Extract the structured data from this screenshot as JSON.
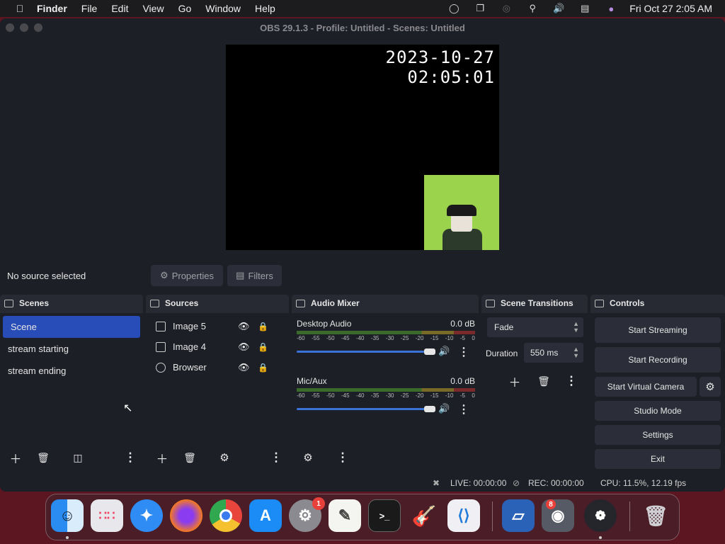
{
  "menubar": {
    "apple": "",
    "items": [
      "Finder",
      "File",
      "Edit",
      "View",
      "Go",
      "Window",
      "Help"
    ],
    "clock": "Fri Oct 27  2:05 AM",
    "status_icons": [
      "creative-cloud-icon",
      "display-icon",
      "airdrop-icon",
      "search-icon",
      "volume-icon",
      "control-center-icon",
      "siri-icon"
    ]
  },
  "window": {
    "title": "OBS 29.1.3 - Profile: Untitled - Scenes: Untitled"
  },
  "preview": {
    "date": "2023-10-27",
    "time": "02:05:01"
  },
  "source_toolbar": {
    "status": "No source selected",
    "properties": "Properties",
    "filters": "Filters"
  },
  "scenes": {
    "title": "Scenes",
    "items": [
      "Scene",
      "stream starting",
      "stream ending"
    ],
    "selected": 0
  },
  "sources": {
    "title": "Sources",
    "items": [
      {
        "label": "Image 5",
        "icon": "image-icon"
      },
      {
        "label": "Image 4",
        "icon": "image-icon"
      },
      {
        "label": "Browser",
        "icon": "globe-icon"
      }
    ]
  },
  "mixer": {
    "title": "Audio Mixer",
    "scale": [
      "-60",
      "-55",
      "-50",
      "-45",
      "-40",
      "-35",
      "-30",
      "-25",
      "-20",
      "-15",
      "-10",
      "-5",
      "0"
    ],
    "channels": [
      {
        "name": "Desktop Audio",
        "db": "0.0 dB",
        "level": 0.96
      },
      {
        "name": "Mic/Aux",
        "db": "0.0 dB",
        "level": 0.96
      }
    ]
  },
  "transitions": {
    "title": "Scene Transitions",
    "selected": "Fade",
    "duration_label": "Duration",
    "duration_value": "550 ms"
  },
  "controls": {
    "title": "Controls",
    "start_streaming": "Start Streaming",
    "start_recording": "Start Recording",
    "start_virtual_camera": "Start Virtual Camera",
    "studio_mode": "Studio Mode",
    "settings": "Settings",
    "exit": "Exit"
  },
  "status": {
    "live": "LIVE: 00:00:00",
    "rec": "REC: 00:00:00",
    "cpu": "CPU: 11.5%, 12.19 fps"
  },
  "dock": {
    "apps": [
      "finder",
      "launchpad",
      "safari",
      "firefox",
      "chrome",
      "app-store",
      "system-settings",
      "textedit",
      "terminal",
      "garageband",
      "vscode",
      "virtualbox",
      "racing-game",
      "obs",
      "trash"
    ],
    "settings_badge": "1",
    "game_badge": "8"
  },
  "colors": {
    "accent": "#284cb8",
    "panel": "#272a33",
    "background": "#1d1f26",
    "green_source": "#9bd34c"
  }
}
